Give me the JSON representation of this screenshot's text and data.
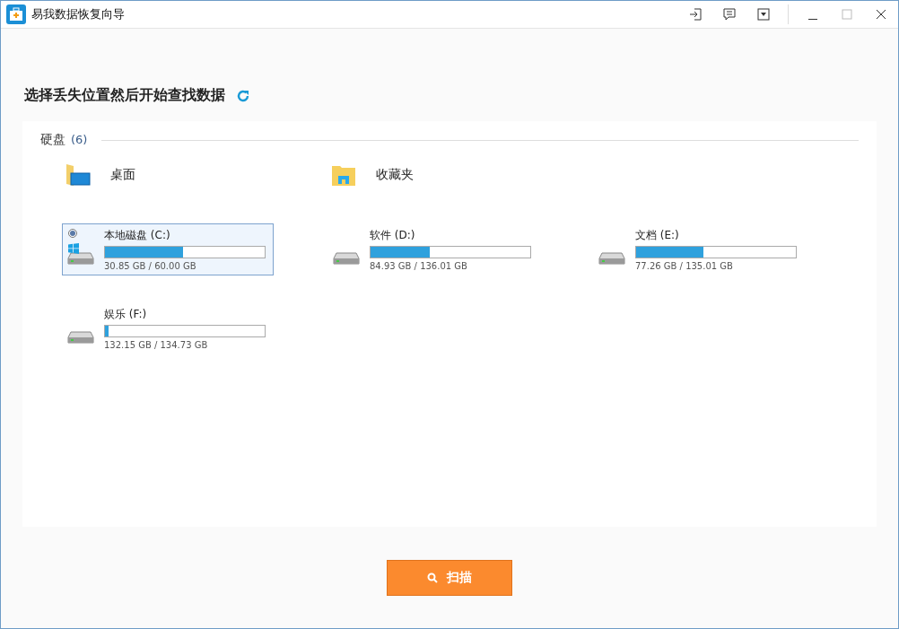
{
  "window": {
    "title": "易我数据恢复向导"
  },
  "heading": "选择丢失位置然后开始查找数据",
  "section": {
    "label": "硬盘",
    "count": "(6)"
  },
  "locations": [
    {
      "kind": "desktop",
      "label": "桌面"
    },
    {
      "kind": "favorites",
      "label": "收藏夹"
    }
  ],
  "drives": [
    {
      "name": "本地磁盘 (C:)",
      "usage": "30.85 GB / 60.00 GB",
      "level": 0.49,
      "system": true,
      "selected": true
    },
    {
      "name": "软件 (D:)",
      "usage": "84.93 GB / 136.01 GB",
      "level": 0.37,
      "system": false,
      "selected": false
    },
    {
      "name": "文档 (E:)",
      "usage": "77.26 GB / 135.01 GB",
      "level": 0.42,
      "system": false,
      "selected": false
    },
    {
      "name": "娱乐 (F:)",
      "usage": "132.15 GB / 134.73 GB",
      "level": 0.02,
      "system": false,
      "selected": false
    }
  ],
  "scan_button": "扫描"
}
